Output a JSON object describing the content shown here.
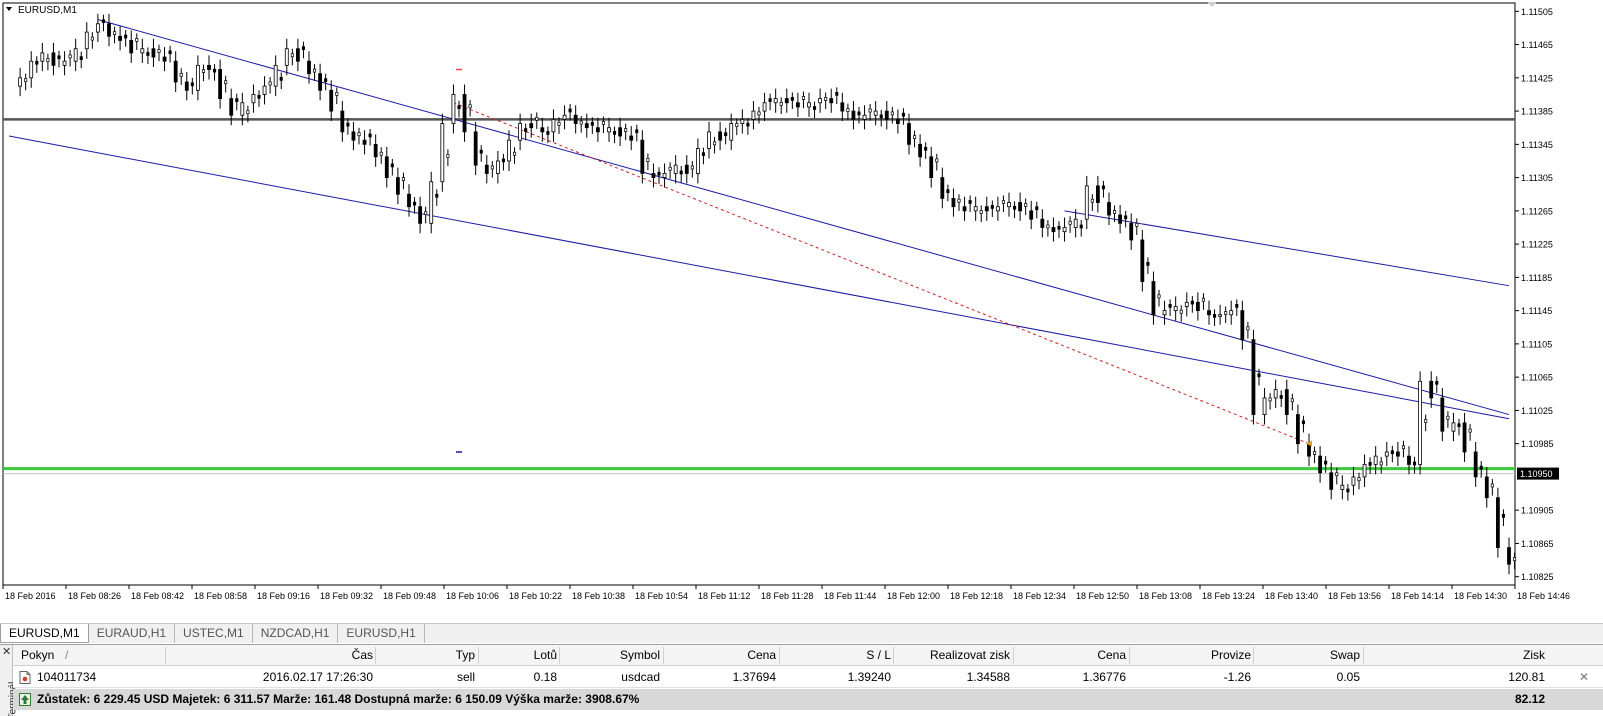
{
  "chart": {
    "symbol_label": "EURUSD,M1",
    "current_price": "1.10950",
    "price_axis": [
      "1.11505",
      "1.11465",
      "1.11425",
      "1.11385",
      "1.11345",
      "1.11305",
      "1.11265",
      "1.11225",
      "1.11185",
      "1.11145",
      "1.11105",
      "1.11065",
      "1.11025",
      "1.10985",
      "1.10905",
      "1.10865",
      "1.10825"
    ],
    "time_axis": [
      "18 Feb 2016",
      "18 Feb 08:26",
      "18 Feb 08:42",
      "18 Feb 08:58",
      "18 Feb 09:16",
      "18 Feb 09:32",
      "18 Feb 09:48",
      "18 Feb 10:06",
      "18 Feb 10:22",
      "18 Feb 10:38",
      "18 Feb 10:54",
      "18 Feb 11:12",
      "18 Feb 11:28",
      "18 Feb 11:44",
      "18 Feb 12:00",
      "18 Feb 12:18",
      "18 Feb 12:34",
      "18 Feb 12:50",
      "18 Feb 13:08",
      "18 Feb 13:24",
      "18 Feb 13:40",
      "18 Feb 13:56",
      "18 Feb 14:14",
      "18 Feb 14:30",
      "18 Feb 14:46"
    ],
    "colors": {
      "background": "#ffffff",
      "candle": "#000000",
      "channel": "#1a1aa6",
      "horizontal_line_gray": "#555555",
      "horizontal_line_green": "#3cc83c",
      "trend_dashed": "#cc2222"
    },
    "horizontal_levels": [
      1.11375,
      1.10955
    ],
    "price_path": [
      [
        0,
        1.11415
      ],
      [
        1,
        1.11425
      ],
      [
        2,
        1.11445
      ],
      [
        3,
        1.11455
      ],
      [
        4,
        1.1144
      ],
      [
        5,
        1.11445
      ],
      [
        6,
        1.1146
      ],
      [
        7,
        1.1148
      ],
      [
        8,
        1.1149
      ],
      [
        9,
        1.11475
      ],
      [
        10,
        1.1147
      ],
      [
        11,
        1.11455
      ],
      [
        12,
        1.1146
      ],
      [
        13,
        1.1145
      ],
      [
        14,
        1.11445
      ],
      [
        15,
        1.1142
      ],
      [
        16,
        1.1141
      ],
      [
        17,
        1.1144
      ],
      [
        18,
        1.11435
      ],
      [
        19,
        1.114
      ],
      [
        20,
        1.1138
      ],
      [
        21,
        1.11395
      ],
      [
        22,
        1.11405
      ],
      [
        23,
        1.11415
      ],
      [
        24,
        1.1144
      ],
      [
        25,
        1.1146
      ],
      [
        26,
        1.11445
      ],
      [
        27,
        1.1143
      ],
      [
        28,
        1.1141
      ],
      [
        29,
        1.11385
      ],
      [
        30,
        1.1136
      ],
      [
        31,
        1.1135
      ],
      [
        32,
        1.11345
      ],
      [
        33,
        1.1133
      ],
      [
        34,
        1.11305
      ],
      [
        35,
        1.11285
      ],
      [
        36,
        1.1127
      ],
      [
        37,
        1.1125
      ],
      [
        38,
        1.113
      ],
      [
        39,
        1.1137
      ],
      [
        40,
        1.11405
      ],
      [
        41,
        1.1136
      ],
      [
        42,
        1.1132
      ],
      [
        43,
        1.1131
      ],
      [
        44,
        1.11325
      ],
      [
        45,
        1.1135
      ],
      [
        46,
        1.1137
      ],
      [
        47,
        1.11365
      ],
      [
        48,
        1.1136
      ],
      [
        49,
        1.11375
      ],
      [
        50,
        1.1138
      ],
      [
        51,
        1.1137
      ],
      [
        52,
        1.11365
      ],
      [
        53,
        1.1136
      ],
      [
        54,
        1.11365
      ],
      [
        55,
        1.11355
      ],
      [
        56,
        1.1135
      ],
      [
        57,
        1.1131
      ],
      [
        58,
        1.11305
      ],
      [
        59,
        1.1131
      ],
      [
        60,
        1.1132
      ],
      [
        61,
        1.1131
      ],
      [
        62,
        1.1134
      ],
      [
        63,
        1.1136
      ],
      [
        64,
        1.1135
      ],
      [
        65,
        1.1137
      ],
      [
        66,
        1.11375
      ],
      [
        67,
        1.11385
      ],
      [
        68,
        1.11395
      ],
      [
        69,
        1.114
      ],
      [
        70,
        1.11395
      ],
      [
        71,
        1.1139
      ],
      [
        72,
        1.11395
      ],
      [
        73,
        1.114
      ],
      [
        74,
        1.11395
      ],
      [
        75,
        1.11385
      ],
      [
        76,
        1.11375
      ],
      [
        77,
        1.1138
      ],
      [
        78,
        1.11385
      ],
      [
        79,
        1.11375
      ],
      [
        80,
        1.1137
      ],
      [
        81,
        1.11345
      ],
      [
        82,
        1.1133
      ],
      [
        83,
        1.11305
      ],
      [
        84,
        1.1128
      ],
      [
        85,
        1.1127
      ],
      [
        86,
        1.11265
      ],
      [
        87,
        1.1127
      ],
      [
        88,
        1.11265
      ],
      [
        89,
        1.1127
      ],
      [
        90,
        1.11275
      ],
      [
        91,
        1.11265
      ],
      [
        92,
        1.11255
      ],
      [
        93,
        1.11245
      ],
      [
        94,
        1.1124
      ],
      [
        95,
        1.11245
      ],
      [
        96,
        1.11255
      ],
      [
        97,
        1.11295
      ],
      [
        98,
        1.11275
      ],
      [
        99,
        1.1126
      ],
      [
        100,
        1.1125
      ],
      [
        101,
        1.1123
      ],
      [
        102,
        1.1118
      ],
      [
        103,
        1.1114
      ],
      [
        104,
        1.11145
      ],
      [
        105,
        1.1115
      ],
      [
        106,
        1.11155
      ],
      [
        107,
        1.11145
      ],
      [
        108,
        1.1114
      ],
      [
        109,
        1.1114
      ],
      [
        110,
        1.11145
      ],
      [
        111,
        1.1111
      ],
      [
        112,
        1.1102
      ],
      [
        113,
        1.1104
      ],
      [
        114,
        1.1105
      ],
      [
        115,
        1.1102
      ],
      [
        116,
        1.10985
      ],
      [
        117,
        1.1097
      ],
      [
        118,
        1.1095
      ],
      [
        119,
        1.1093
      ],
      [
        120,
        1.10935
      ],
      [
        121,
        1.10945
      ],
      [
        122,
        1.1096
      ],
      [
        123,
        1.1097
      ],
      [
        124,
        1.10975
      ],
      [
        125,
        1.1097
      ],
      [
        126,
        1.1096
      ],
      [
        127,
        1.1106
      ],
      [
        128,
        1.1104
      ],
      [
        129,
        1.11
      ],
      [
        130,
        1.1101
      ],
      [
        131,
        1.10975
      ],
      [
        132,
        1.10945
      ],
      [
        133,
        1.1092
      ],
      [
        134,
        1.1086
      ],
      [
        135,
        1.1084
      ]
    ],
    "channel_upper": [
      [
        8,
        1.11495
      ],
      [
        135,
        1.1102
      ]
    ],
    "channel_upper2": [
      [
        95,
        1.11265
      ],
      [
        135,
        1.11175
      ]
    ],
    "channel_lower": [
      [
        0,
        1.11355
      ],
      [
        135,
        1.11015
      ]
    ],
    "trend_dashed": [
      [
        40,
        1.11395
      ],
      [
        117,
        1.10985
      ]
    ],
    "markers": [
      {
        "x": 40.5,
        "y": 1.11435,
        "color": "#ff4444"
      },
      {
        "x": 40.5,
        "y": 1.10975,
        "color": "#1a1aa6"
      }
    ]
  },
  "tabs": [
    "EURUSD,M1",
    "EURAUD,H1",
    "USTEC,M1",
    "NZDCAD,H1",
    "EURUSD,H1"
  ],
  "terminal": {
    "side_label": "Terminál",
    "headers": [
      "Pokyn",
      "/",
      "Čas",
      "Typ",
      "Lotů",
      "Symbol",
      "Cena",
      "S / L",
      "Realizovat zisk",
      "Cena",
      "Provize",
      "Swap",
      "Zisk"
    ],
    "order": {
      "ticket": "104011734",
      "time": "2016.02.17 17:26:30",
      "type": "sell",
      "lots": "0.18",
      "symbol": "usdcad",
      "price": "1.37694",
      "sl": "1.39240",
      "tp": "1.34588",
      "current_price": "1.36776",
      "commission": "-1.26",
      "swap": "0.05",
      "profit": "120.81"
    },
    "summary": {
      "text": "Zůstatek: 6 229.45 USD  Majetek: 6 311.57  Marže: 161.48  Dostupná marže: 6 150.09  Výška marže: 3908.67%",
      "profit": "82.12"
    }
  }
}
